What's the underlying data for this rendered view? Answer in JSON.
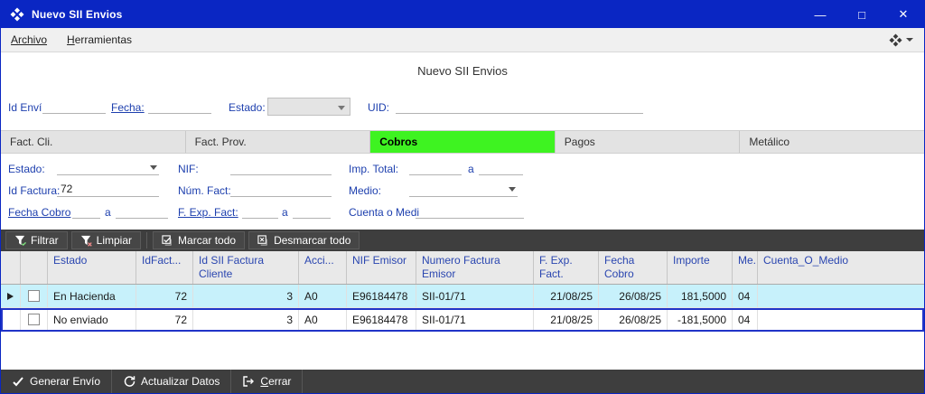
{
  "window": {
    "title": "Nuevo SII Envios",
    "minimize": "—",
    "maximize": "□",
    "close": "✕"
  },
  "menubar": {
    "archivo": "Archivo",
    "herramientas": "Herramientas"
  },
  "header": {
    "form_title": "Nuevo SII Envios",
    "id_envi_label": "Id Enví",
    "fecha_label": "Fecha:",
    "estado_label": "Estado:",
    "uid_label": "UID:"
  },
  "tabs": [
    {
      "label": "Fact. Cli."
    },
    {
      "label": "Fact. Prov."
    },
    {
      "label": "Cobros"
    },
    {
      "label": "Pagos"
    },
    {
      "label": "Metálico"
    }
  ],
  "filters": {
    "row1": {
      "estado_label": "Estado:",
      "nif_label": "NIF:",
      "imp_total_label": "Imp. Total:",
      "range_sep": "a"
    },
    "row2": {
      "id_factura_label": "Id Factura:",
      "id_factura_value": "72",
      "num_fact_label": "Núm. Fact:",
      "medio_label": "Medio:"
    },
    "row3": {
      "fecha_cobro_label": "Fecha Cobro",
      "range_sep1": "a",
      "f_exp_fact_label": "F. Exp. Fact:",
      "range_sep2": "a",
      "cuenta_label": "Cuenta o Medi"
    }
  },
  "grid_toolbar": {
    "filtrar": "Filtrar",
    "limpiar": "Limpiar",
    "marcar_todo": "Marcar todo",
    "desmarcar_todo": "Desmarcar todo"
  },
  "grid": {
    "columns": {
      "estado": "Estado",
      "idfact": "IdFact...",
      "id_sii": "Id SII Factura Cliente",
      "acci": "Acci...",
      "nif": "NIF Emisor",
      "numero": "Numero Factura Emisor",
      "f_exp": "F. Exp. Fact.",
      "fecha_cobro": "Fecha Cobro",
      "importe": "Importe",
      "me": "Me...",
      "cuenta": "Cuenta_O_Medio"
    },
    "rows": [
      {
        "estado": "En Hacienda",
        "idfact": "72",
        "id_sii": "3",
        "acci": "A0",
        "nif": "E96184478",
        "numero": "SII-01/71",
        "f_exp": "21/08/25",
        "fecha_cobro": "26/08/25",
        "importe": "181,5000",
        "me": "04",
        "cuenta": ""
      },
      {
        "estado": "No enviado",
        "idfact": "72",
        "id_sii": "3",
        "acci": "A0",
        "nif": "E96184478",
        "numero": "SII-01/71",
        "f_exp": "21/08/25",
        "fecha_cobro": "26/08/25",
        "importe": "-181,5000",
        "me": "04",
        "cuenta": ""
      }
    ]
  },
  "footer": {
    "generar": "Generar Envío",
    "actualizar": "Actualizar Datos",
    "cerrar": "Cerrar"
  },
  "colors": {
    "titlebar_blue": "#0a26c3",
    "active_tab_green": "#3ef321",
    "current_row_cyan": "#c7f1fb",
    "selection_border_blue": "#2134c8",
    "toolbar_dark": "#3e3e3e",
    "label_blue": "#1d3fae",
    "header_text_blue": "#2a46b0"
  }
}
